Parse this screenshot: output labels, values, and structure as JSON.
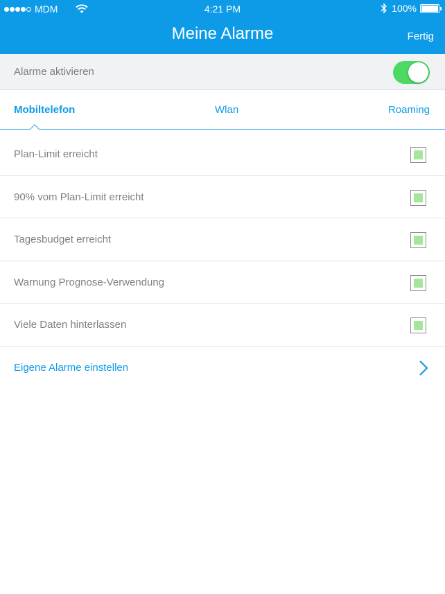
{
  "status_bar": {
    "carrier": "MDM",
    "time": "4:21 PM",
    "battery": "100%"
  },
  "nav": {
    "title": "Meine Alarme",
    "done_label": "Fertig"
  },
  "activate": {
    "label": "Alarme aktivieren",
    "enabled": true
  },
  "tabs": [
    {
      "label": "Mobiltelefon",
      "active": true
    },
    {
      "label": "Wlan",
      "active": false
    },
    {
      "label": "Roaming",
      "active": false
    }
  ],
  "alarms": [
    {
      "label": "Plan-Limit erreicht",
      "checked": true
    },
    {
      "label": "90% vom Plan-Limit erreicht",
      "checked": true
    },
    {
      "label": "Tagesbudget erreicht",
      "checked": true
    },
    {
      "label": "Warnung Prognose-Verwendung",
      "checked": true
    },
    {
      "label": "Viele Daten hinterlassen",
      "checked": true
    }
  ],
  "custom_alarms_label": "Eigene Alarme einstellen",
  "colors": {
    "accent": "#0d9be8",
    "toggle_on": "#4cd964",
    "check_fill": "#a4e79b"
  }
}
